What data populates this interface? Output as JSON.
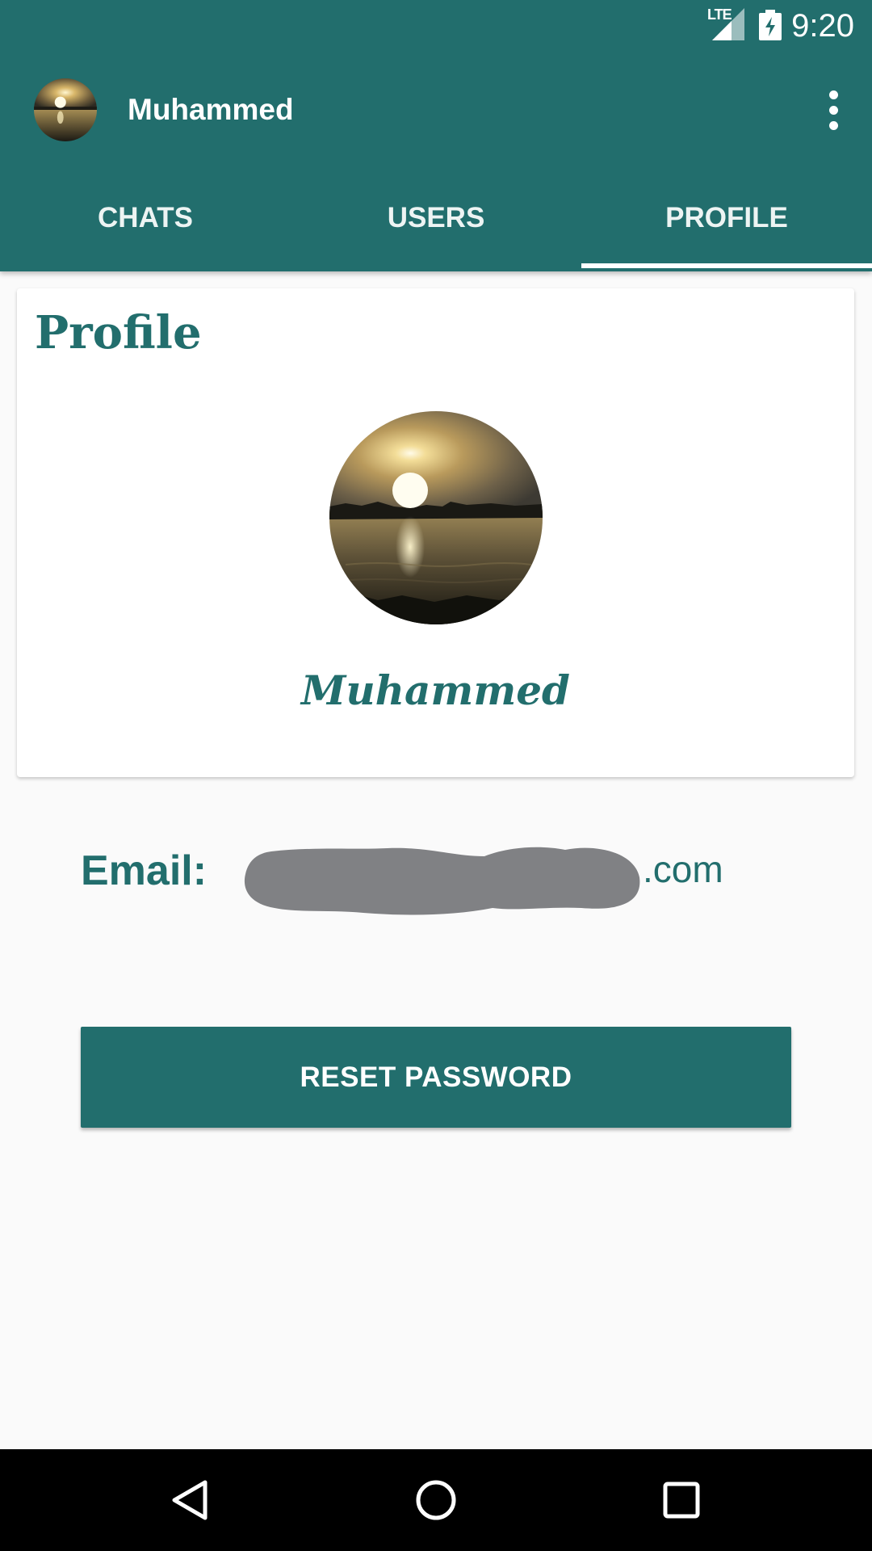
{
  "status_bar": {
    "time": "9:20",
    "network": "LTE",
    "icons": [
      "lte-signal-icon",
      "battery-charging-icon"
    ]
  },
  "toolbar": {
    "title": "Muhammed",
    "avatar_icon": "sunset-lake-avatar",
    "menu_icon": "more-vert-icon"
  },
  "tabs": [
    {
      "label": "CHATS",
      "active": false
    },
    {
      "label": "USERS",
      "active": false
    },
    {
      "label": "PROFILE",
      "active": true
    }
  ],
  "profile": {
    "heading": "Profile",
    "name": "Muhammed",
    "photo_icon": "sunset-lake-photo"
  },
  "email": {
    "label": "Email:",
    "visible_suffix": ".com",
    "redacted": true
  },
  "actions": {
    "reset_password_label": "RESET PASSWORD"
  },
  "navigation": {
    "back_icon": "back-triangle-icon",
    "home_icon": "home-circle-icon",
    "recents_icon": "recents-square-icon"
  },
  "colors": {
    "primary": "#226E6D",
    "background": "#FAFAFA",
    "card": "#FFFFFF",
    "redaction": "#808184"
  }
}
